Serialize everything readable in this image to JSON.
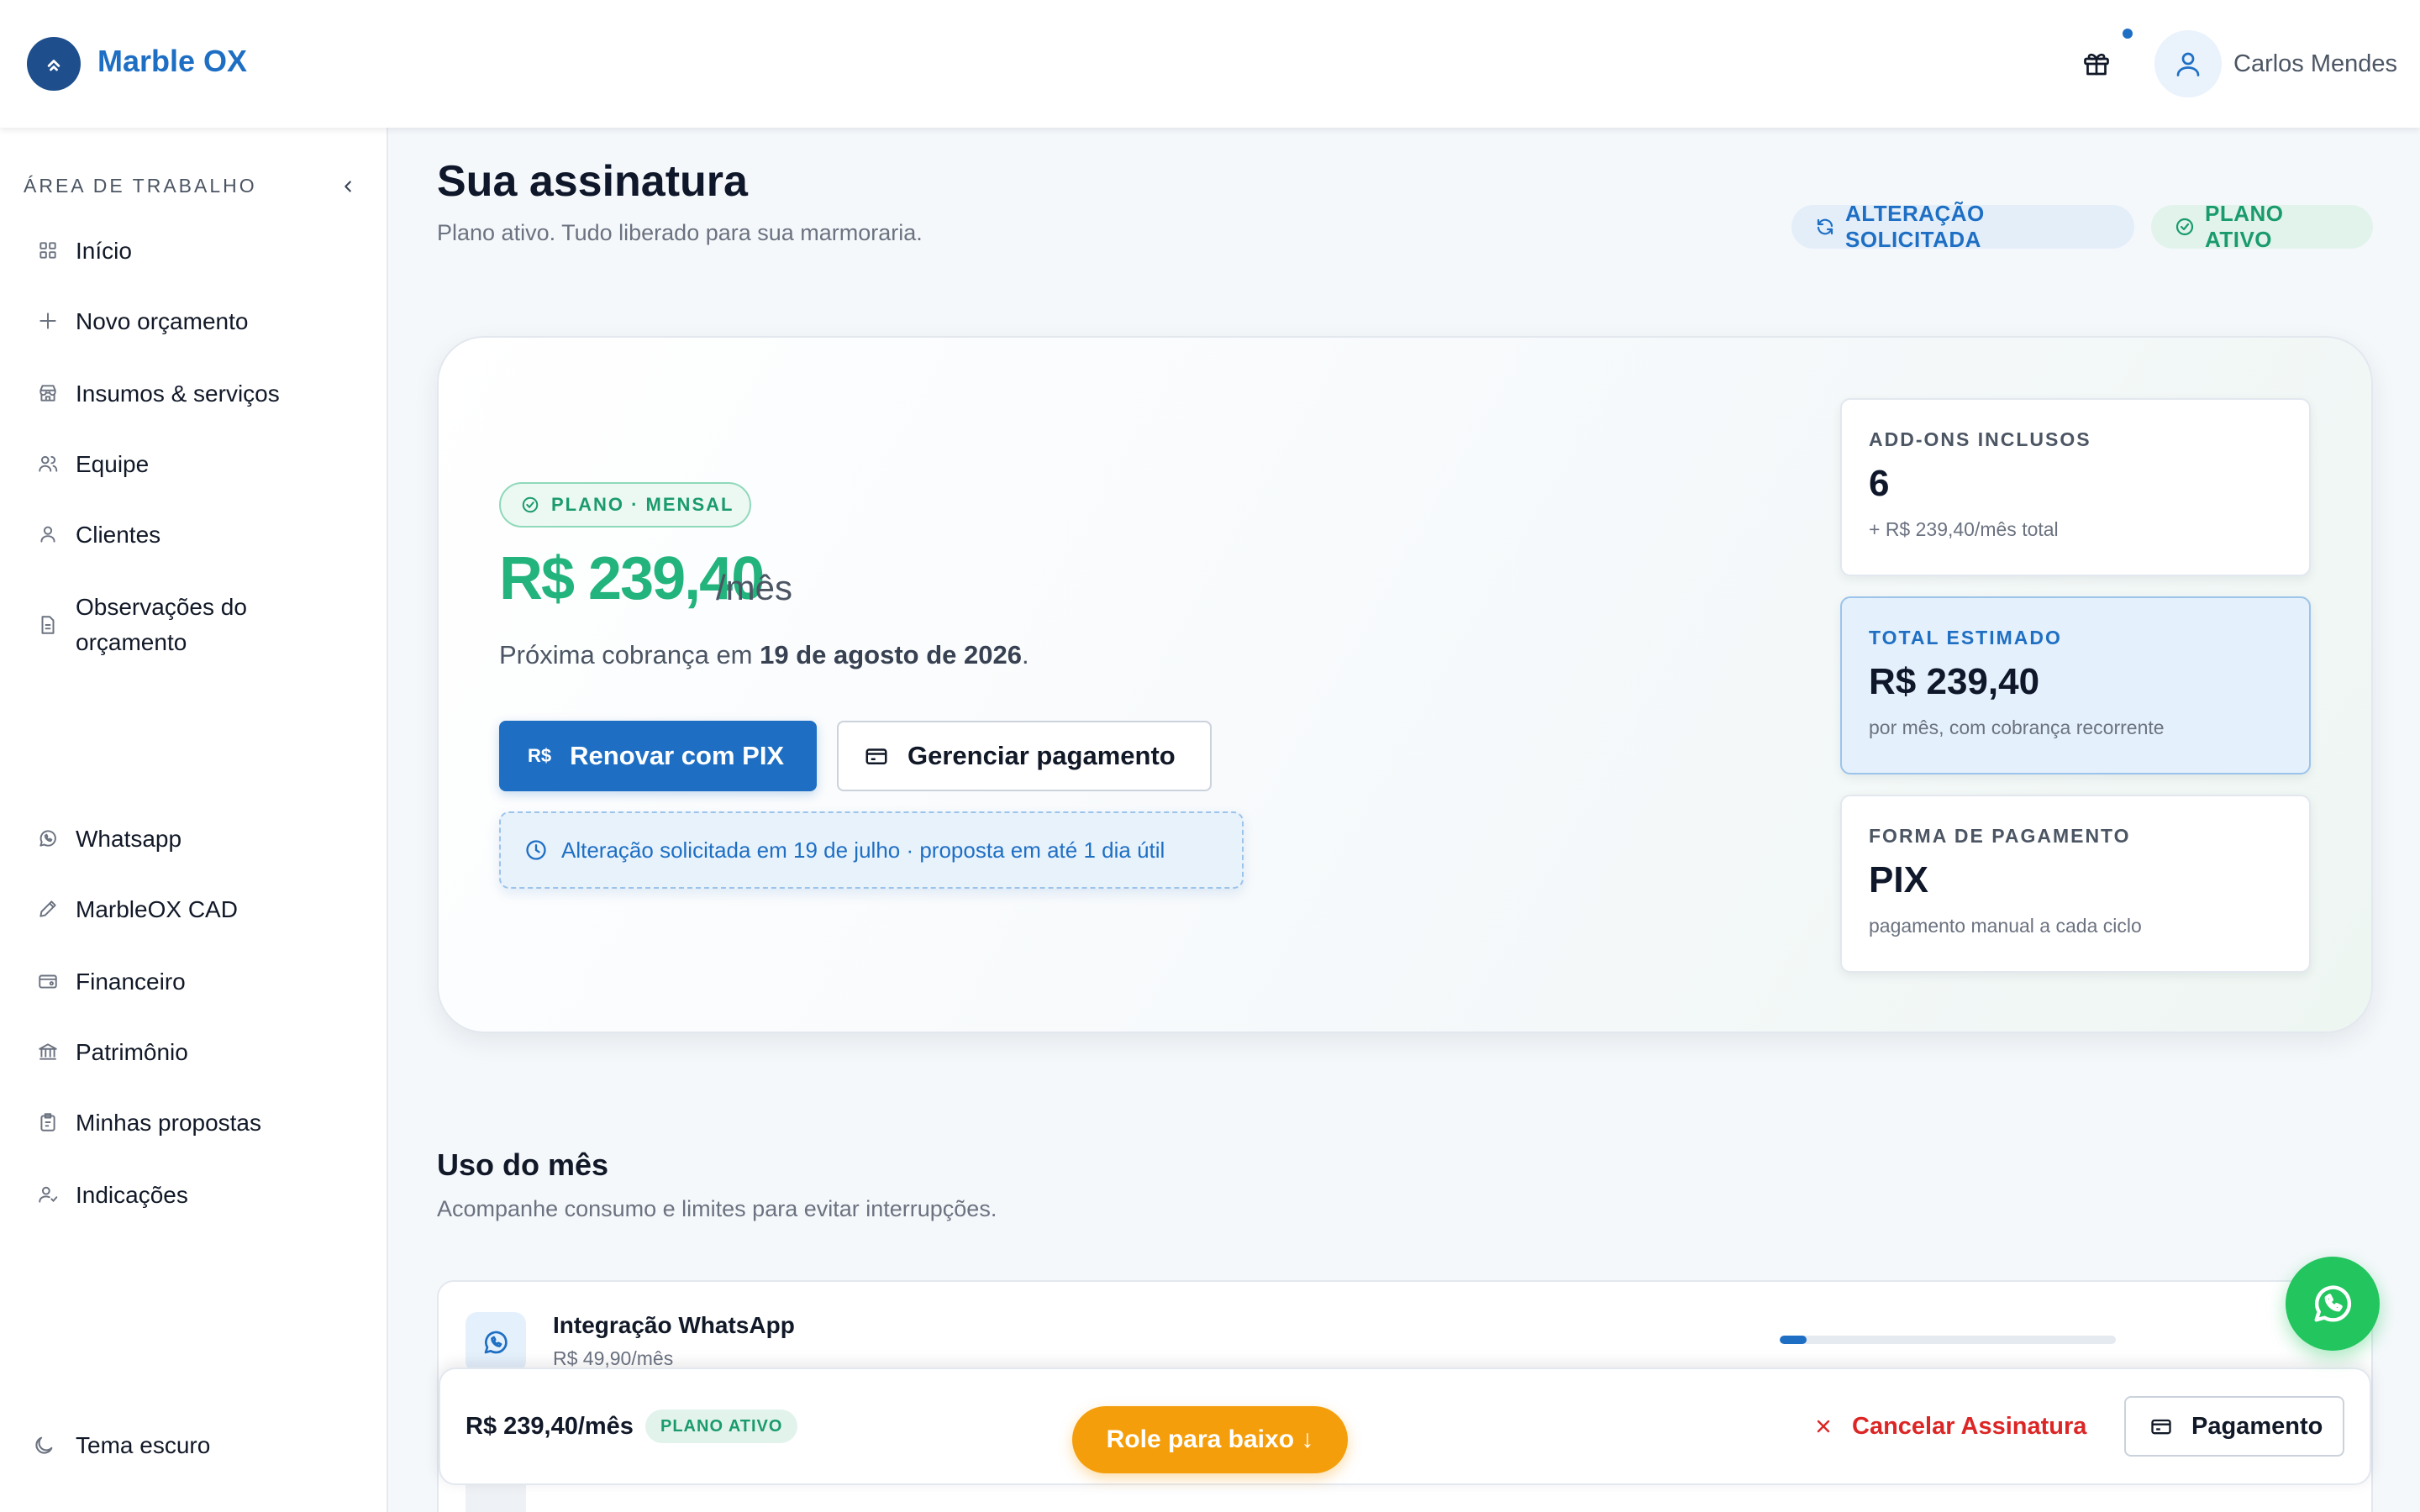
{
  "app": {
    "name": "Marble OX"
  },
  "header": {
    "user_name": "Carlos Mendes"
  },
  "sidebar": {
    "section_title": "ÁREA DE TRABALHO",
    "items": [
      {
        "label": "Início",
        "icon": "grid-icon"
      },
      {
        "label": "Novo orçamento",
        "icon": "plus-icon"
      },
      {
        "label": "Insumos & serviços",
        "icon": "store-icon"
      },
      {
        "label": "Equipe",
        "icon": "users-icon"
      },
      {
        "label": "Clientes",
        "icon": "user-icon"
      },
      {
        "label": "Observações do orçamento",
        "icon": "document-icon"
      },
      {
        "label": "Whatsapp",
        "icon": "whatsapp-icon"
      },
      {
        "label": "MarbleOX CAD",
        "icon": "pencil-icon"
      },
      {
        "label": "Financeiro",
        "icon": "wallet-icon"
      },
      {
        "label": "Patrimônio",
        "icon": "bank-icon"
      },
      {
        "label": "Minhas propostas",
        "icon": "clipboard-icon"
      },
      {
        "label": "Indicações",
        "icon": "user-referral-icon"
      }
    ],
    "theme_toggle": "Tema escuro"
  },
  "page": {
    "title": "Sua assinatura",
    "subtitle": "Plano ativo. Tudo liberado para sua marmoraria.",
    "chip_change": "ALTERAÇÃO SOLICITADA",
    "chip_active": "PLANO ATIVO"
  },
  "plan": {
    "badge": "PLANO · MENSAL",
    "price": "R$ 239,40",
    "unit": "/mês",
    "next_charge_prefix": "Próxima cobrança em ",
    "next_charge_date": "19 de agosto de 2026",
    "next_charge_suffix": ".",
    "btn_pix_currency": "R$",
    "btn_pix": "Renovar com PIX",
    "btn_manage": "Gerenciar pagamento",
    "change_note": "Alteração solicitada em 19 de julho · proposta em até 1 dia útil"
  },
  "info_cards": [
    {
      "label": "ADD-ONS INCLUSOS",
      "value": "6",
      "sub": "+ R$ 239,40/mês total"
    },
    {
      "label": "TOTAL ESTIMADO",
      "value": "R$ 239,40",
      "sub": "por mês, com cobrança recorrente"
    },
    {
      "label": "FORMA DE PAGAMENTO",
      "value": "PIX",
      "sub": "pagamento manual a cada ciclo"
    }
  ],
  "usage": {
    "title": "Uso do mês",
    "subtitle": "Acompanhe consumo e limites para evitar interrupções.",
    "items": [
      {
        "name": "Integração WhatsApp",
        "price": "R$ 49,90/mês",
        "progress_percent": 8
      }
    ]
  },
  "bottom_bar": {
    "price": "R$ 239,40/mês",
    "chip": "PLANO ATIVO",
    "scroll_button": "Role para baixo ↓",
    "cancel": "Cancelar Assinatura",
    "payment": "Pagamento"
  },
  "colors": {
    "brand": "#1e6fc4",
    "success": "#22b47c",
    "danger": "#dc2626",
    "warning": "#f59e0b",
    "whatsapp": "#22c55e"
  }
}
